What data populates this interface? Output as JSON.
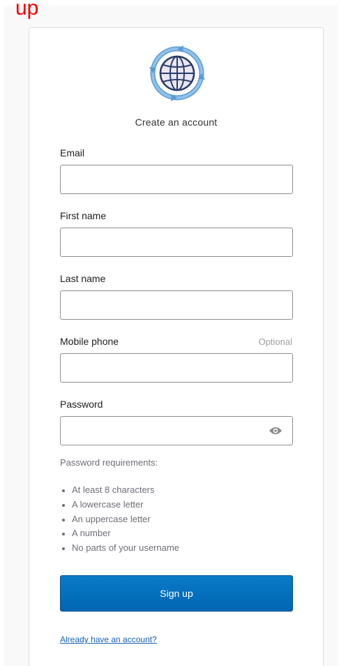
{
  "annotation": {
    "text": "up",
    "color": "#ee0000"
  },
  "form": {
    "title": "Create an account",
    "fields": {
      "email": {
        "label": "Email",
        "value": ""
      },
      "first_name": {
        "label": "First name",
        "value": ""
      },
      "last_name": {
        "label": "Last name",
        "value": ""
      },
      "mobile_phone": {
        "label": "Mobile phone",
        "optional_text": "Optional",
        "value": ""
      },
      "password": {
        "label": "Password",
        "value": "",
        "toggle_icon": "eye-icon"
      }
    },
    "requirements": {
      "title": "Password requirements:",
      "items": [
        "At least 8 characters",
        "A lowercase letter",
        "An uppercase letter",
        "A number",
        "No parts of your username"
      ]
    },
    "submit_label": "Sign up",
    "signin_link": "Already have an account?",
    "logo_icon": "globe-with-arrows-icon"
  },
  "colors": {
    "primary_button": "#0a74c2",
    "link": "#1662b8",
    "annotation": "#ee0000"
  }
}
